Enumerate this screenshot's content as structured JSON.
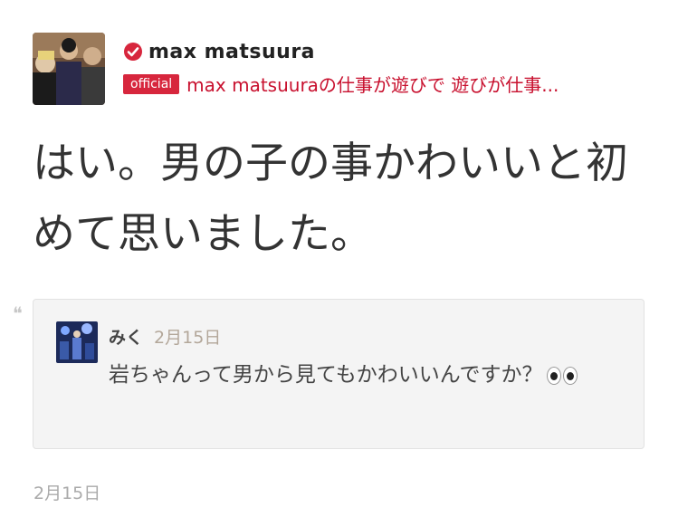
{
  "header": {
    "author_name": "max matsuura",
    "official_badge": "official",
    "blog_title": "max matsuuraの仕事が遊びで 遊びが仕事..."
  },
  "reply": {
    "text": "はい。男の子の事かわいいと初めて思いました。"
  },
  "comment": {
    "name": "みく",
    "date": "2月15日",
    "body": "岩ちゃんって男から見てもかわいいんですか？",
    "emoji": "eyes-emoji"
  },
  "post_date": "2月15日",
  "icons": {
    "verified": "verified-check-icon",
    "quote": "quote-icon"
  },
  "colors": {
    "accent_red": "#d7263d",
    "link_red": "#c8102e"
  }
}
